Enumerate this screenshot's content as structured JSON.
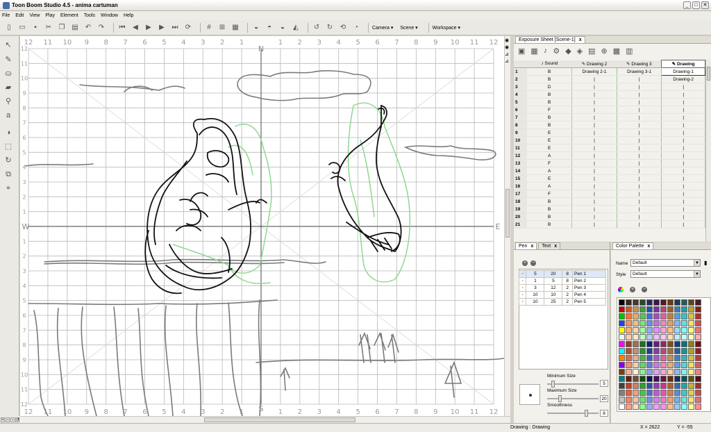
{
  "window": {
    "title": "Toon Boom Studio 4.5 - anima cartuman",
    "minimize": "_",
    "maximize": "□",
    "close": "✕"
  },
  "menu": [
    "File",
    "Edit",
    "View",
    "Play",
    "Element",
    "Tools",
    "Window",
    "Help"
  ],
  "toolbar": {
    "camera": "Camera ▾",
    "scene": "Scene ▾",
    "workspace": "Workspace ▾"
  },
  "canvas": {
    "top_numbers": [
      "12",
      "11",
      "10",
      "9",
      "8",
      "7",
      "6",
      "5",
      "4",
      "3",
      "2",
      "1",
      "",
      "1",
      "2",
      "3",
      "4",
      "5",
      "6",
      "7",
      "8",
      "9",
      "10",
      "11",
      "12"
    ],
    "bottom_numbers": [
      "12",
      "11",
      "10",
      "9",
      "8",
      "7",
      "6",
      "5",
      "4",
      "3",
      "2",
      "1",
      "",
      "1",
      "2",
      "3",
      "4",
      "5",
      "6",
      "7",
      "8",
      "9",
      "10",
      "11",
      "12"
    ],
    "left_numbers": [
      "12",
      "11",
      "10",
      "9",
      "8",
      "7",
      "6",
      "5",
      "4",
      "3",
      "2",
      "1",
      "",
      "1",
      "2",
      "3",
      "4",
      "5",
      "6",
      "7",
      "8",
      "9",
      "10",
      "11",
      "12"
    ],
    "north": "N",
    "south": "S",
    "west": "W",
    "east": "E"
  },
  "exposure_sheet": {
    "tab_label": "Exposure Sheet [Scene-1]",
    "tab_close": "x",
    "columns": [
      "Sound",
      "Drawing 2",
      "Drawing 3",
      "Drawing"
    ],
    "rows": [
      {
        "n": "1",
        "sound": "B",
        "d2": "Drawing 2-1",
        "d3": "Drawing 3-1",
        "d1": "Drawing-1"
      },
      {
        "n": "2",
        "sound": "B",
        "d2": "|",
        "d3": "|",
        "d1": "Drawing-2"
      },
      {
        "n": "3",
        "sound": "D",
        "d2": "|",
        "d3": "|",
        "d1": "|"
      },
      {
        "n": "4",
        "sound": "B",
        "d2": "|",
        "d3": "|",
        "d1": "|"
      },
      {
        "n": "5",
        "sound": "B",
        "d2": "|",
        "d3": "|",
        "d1": "|"
      },
      {
        "n": "6",
        "sound": "F",
        "d2": "|",
        "d3": "|",
        "d1": "|"
      },
      {
        "n": "7",
        "sound": "B",
        "d2": "|",
        "d3": "|",
        "d1": "|"
      },
      {
        "n": "8",
        "sound": "B",
        "d2": "|",
        "d3": "|",
        "d1": "|"
      },
      {
        "n": "9",
        "sound": "E",
        "d2": "|",
        "d3": "|",
        "d1": "|"
      },
      {
        "n": "10",
        "sound": "E",
        "d2": "|",
        "d3": "|",
        "d1": "|"
      },
      {
        "n": "11",
        "sound": "E",
        "d2": "|",
        "d3": "|",
        "d1": "|"
      },
      {
        "n": "12",
        "sound": "A",
        "d2": "|",
        "d3": "|",
        "d1": "|"
      },
      {
        "n": "13",
        "sound": "F",
        "d2": "|",
        "d3": "|",
        "d1": "|"
      },
      {
        "n": "14",
        "sound": "A",
        "d2": "|",
        "d3": "|",
        "d1": "|"
      },
      {
        "n": "15",
        "sound": "E",
        "d2": "|",
        "d3": "|",
        "d1": "|"
      },
      {
        "n": "16",
        "sound": "A",
        "d2": "|",
        "d3": "|",
        "d1": "|"
      },
      {
        "n": "17",
        "sound": "F",
        "d2": "|",
        "d3": "|",
        "d1": "|"
      },
      {
        "n": "18",
        "sound": "B",
        "d2": "|",
        "d3": "|",
        "d1": "|"
      },
      {
        "n": "19",
        "sound": "B",
        "d2": "|",
        "d3": "|",
        "d1": "|"
      },
      {
        "n": "20",
        "sound": "B",
        "d2": "|",
        "d3": "|",
        "d1": "|"
      },
      {
        "n": "21",
        "sound": "B",
        "d2": "|",
        "d3": "|",
        "d1": "|"
      }
    ]
  },
  "pen_panel": {
    "tabs": [
      {
        "label": "Pen",
        "close": "x"
      },
      {
        "label": "Text",
        "close": "x"
      }
    ],
    "add": "+",
    "remove": "−",
    "pens": [
      {
        "a": "5",
        "b": "20",
        "c": "8",
        "name": "Pen 1"
      },
      {
        "a": "1",
        "b": "5",
        "c": "8",
        "name": "Pen 2"
      },
      {
        "a": "3",
        "b": "12",
        "c": "2",
        "name": "Pen 3"
      },
      {
        "a": "10",
        "b": "10",
        "c": "2",
        "name": "Pen 4"
      },
      {
        "a": "10",
        "b": "25",
        "c": "2",
        "name": "Pen 5"
      }
    ],
    "min_size_label": "Minimum Size",
    "min_size": "5",
    "max_size_label": "Maximum Size",
    "max_size": "20",
    "smooth_label": "Smoothness",
    "smooth": "8"
  },
  "palette_panel": {
    "tab_label": "Color Palette",
    "tab_close": "x",
    "name_label": "Name",
    "name_value": "Default",
    "style_label": "Style",
    "style_value": "Default"
  },
  "status": {
    "mode": "Drawing : Drawing",
    "x": "X = 2622",
    "y": "Y = -55"
  },
  "colors": {
    "accent": "#316ac5",
    "sketch_black": "#111111",
    "sketch_green": "#8fd88f",
    "sketch_gray": "#7a7a7a"
  }
}
